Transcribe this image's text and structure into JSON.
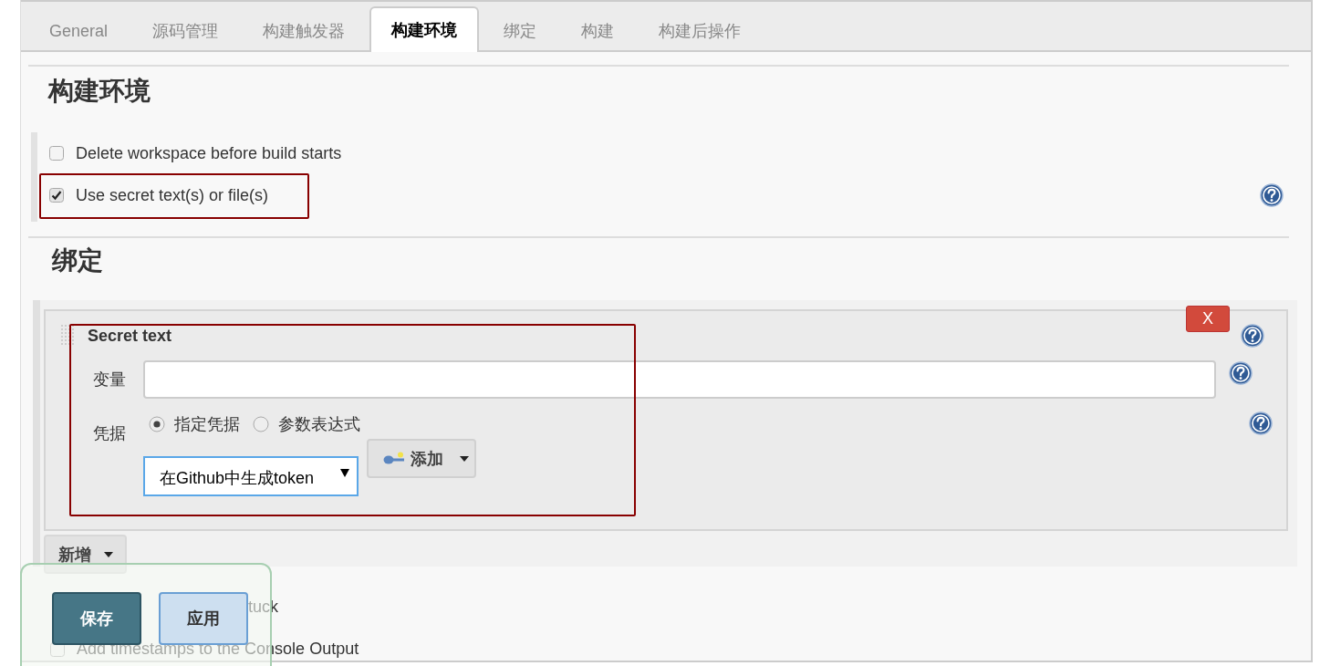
{
  "tabs": [
    {
      "label": "General",
      "selected": false
    },
    {
      "label": "源码管理",
      "selected": false
    },
    {
      "label": "构建触发器",
      "selected": false
    },
    {
      "label": "构建环境",
      "selected": true
    },
    {
      "label": "绑定",
      "selected": false
    },
    {
      "label": "构建",
      "selected": false
    },
    {
      "label": "构建后操作",
      "selected": false
    }
  ],
  "build_environment": {
    "heading": "构建环境",
    "options": [
      {
        "label": "Delete workspace before build starts",
        "checked": false
      },
      {
        "label": "Use secret text(s) or file(s)",
        "checked": true
      }
    ]
  },
  "bindings": {
    "heading": "绑定",
    "items": [
      {
        "title": "Secret text",
        "delete_label": "X",
        "variable": {
          "label": "变量"
        },
        "credentials": {
          "label": "凭据",
          "radios": [
            {
              "label": "指定凭据",
              "selected": true
            },
            {
              "label": "参数表达式",
              "selected": false
            }
          ],
          "select_value": "在Github中生成token",
          "add_button": "添加"
        }
      }
    ],
    "add_button": "新增"
  },
  "more_options": [
    {
      "label": "tuck"
    },
    {
      "label": "Add timestamps to the Console Output",
      "checked": false
    }
  ],
  "save_bar": {
    "save": "保存",
    "apply": "应用"
  }
}
